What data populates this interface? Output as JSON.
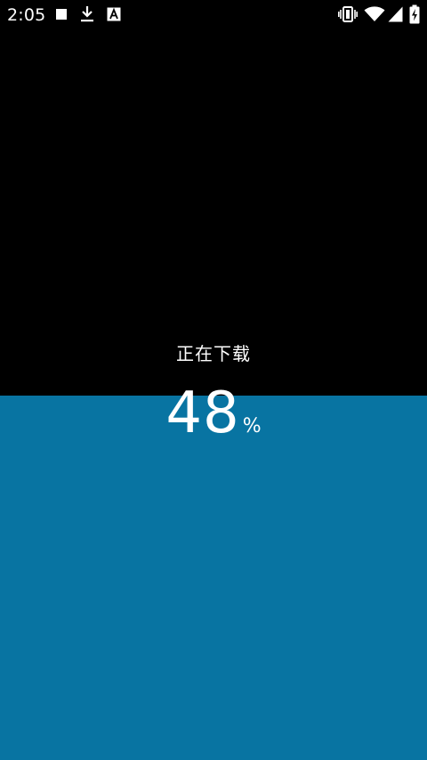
{
  "status_bar": {
    "time": "2:05",
    "notification_icons": [
      "stop-square-icon",
      "download-icon",
      "a-letter-icon"
    ],
    "system_icons": [
      "vibrate-icon",
      "wifi-icon",
      "signal-icon",
      "battery-charging-icon"
    ]
  },
  "download": {
    "label": "正在下载",
    "percent": "48",
    "percent_unit": "%",
    "progress_fraction": 0.48
  },
  "colors": {
    "background": "#000000",
    "progress_fill": "#0874a2",
    "text": "#ffffff"
  }
}
